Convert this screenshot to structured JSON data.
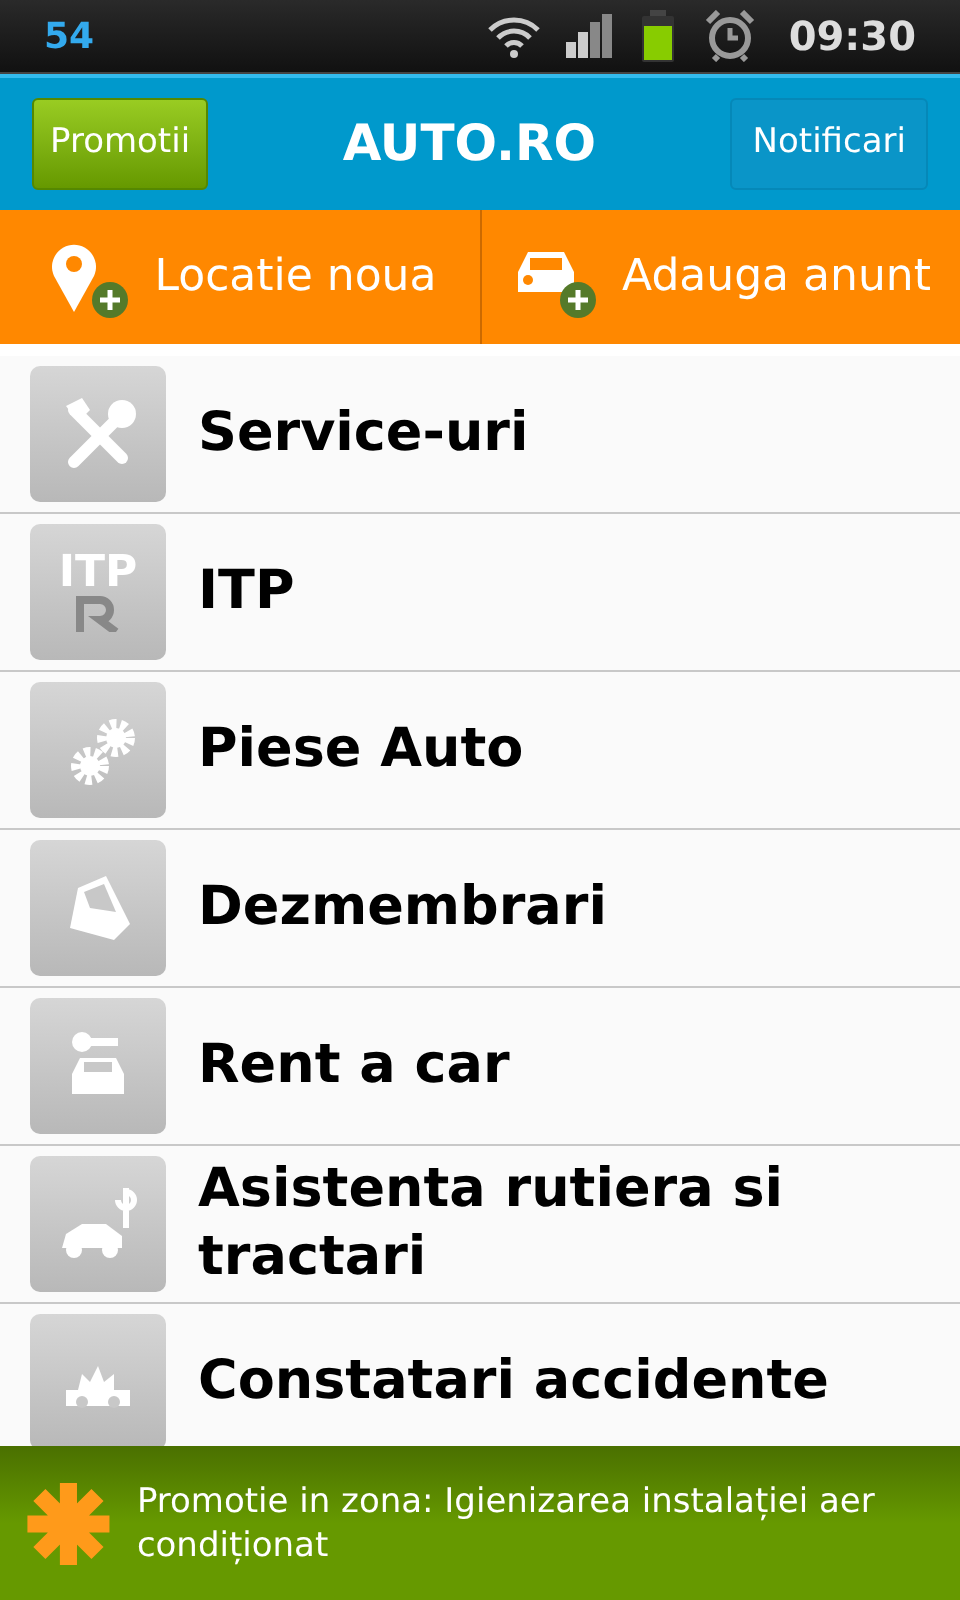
{
  "status_bar": {
    "notification": "54",
    "time": "09:30"
  },
  "header": {
    "left_button": "Promotii",
    "title": "AUTO.RO",
    "right_button": "Notificari"
  },
  "actions": [
    {
      "kind": "location",
      "label": "Locatie noua"
    },
    {
      "kind": "car",
      "label": "Adauga anunt"
    }
  ],
  "categories": [
    {
      "kind": "tools",
      "label": "Service-uri"
    },
    {
      "kind": "itp",
      "icon_text": "ITP",
      "label": "ITP"
    },
    {
      "kind": "gears",
      "label": "Piese Auto"
    },
    {
      "kind": "door",
      "label": "Dezmembrari"
    },
    {
      "kind": "rent",
      "label": "Rent a car"
    },
    {
      "kind": "tow",
      "label": "Asistenta rutiera si tractari"
    },
    {
      "kind": "crash",
      "label": "Constatari accidente"
    }
  ],
  "promo_banner": {
    "text": "Promotie in zona: Igienizarea instalației aer condiționat"
  }
}
